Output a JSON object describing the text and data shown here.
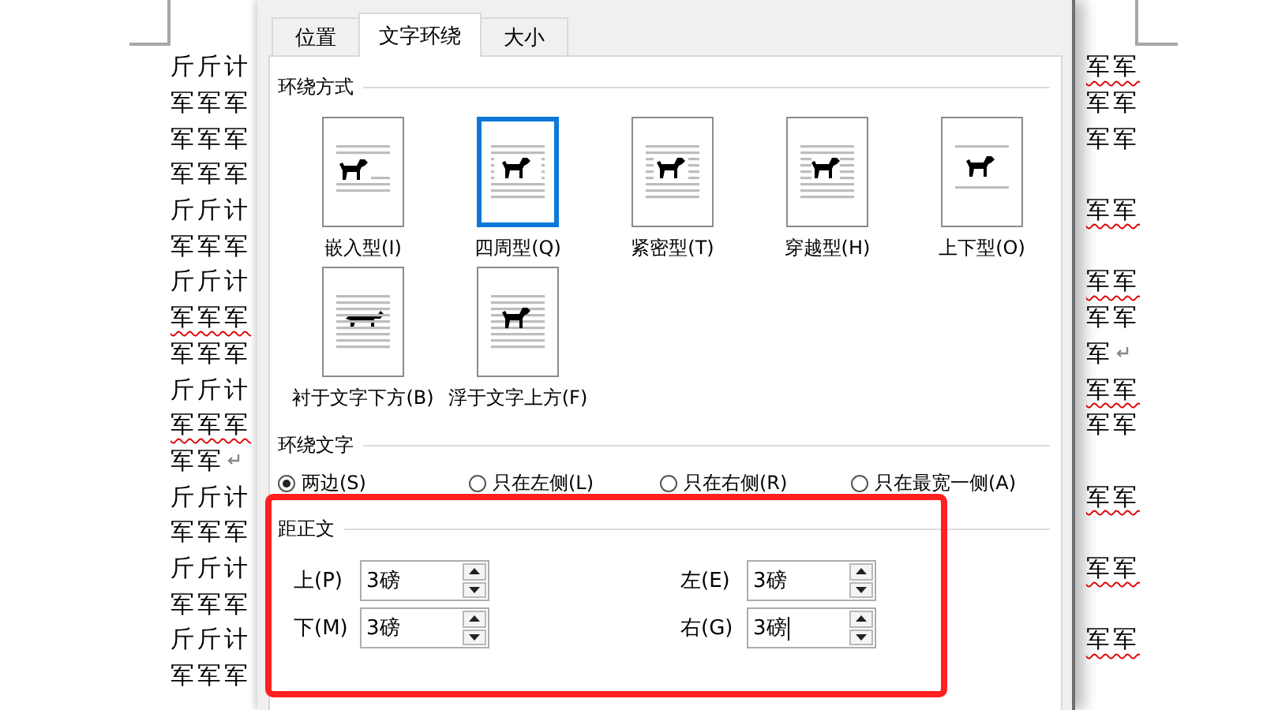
{
  "document": {
    "lines": [
      {
        "left": "斤斤计",
        "right": "军军",
        "left_flagged": false,
        "right_flagged": true
      },
      {
        "left": "军军军",
        "right": "军军",
        "left_flagged": false,
        "right_flagged": false
      },
      {
        "left": "军军军",
        "right": "军军",
        "left_flagged": false,
        "right_flagged": false
      },
      {
        "left": "军军军",
        "left_flagged": false
      },
      {
        "left": "斤斤计",
        "right": "军军",
        "left_flagged": false,
        "right_flagged": true
      },
      {
        "left": "军军军",
        "left_flagged": false
      },
      {
        "left": "斤斤计",
        "right": "军军",
        "left_flagged": false,
        "right_flagged": true
      },
      {
        "left": "军军军",
        "right": "军军",
        "left_flagged": true,
        "right_flagged": false
      },
      {
        "left": "军军军",
        "right": "军",
        "left_flagged": false,
        "right_flagged": false,
        "right_end_mark": true
      },
      {
        "left": "斤斤计",
        "right": "军军",
        "left_flagged": false,
        "right_flagged": true
      },
      {
        "left": "军军军",
        "right": "军军",
        "left_flagged": true,
        "right_flagged": false
      },
      {
        "left": "军军",
        "left_flagged": false,
        "left_end_mark": true
      },
      {
        "left": "斤斤计",
        "right": "军军",
        "left_flagged": false,
        "right_flagged": true
      },
      {
        "left": "军军军",
        "left_flagged": false
      },
      {
        "left": "斤斤计",
        "right": "军军",
        "left_flagged": false,
        "right_flagged": true
      },
      {
        "left": "军军军",
        "left_flagged": false
      },
      {
        "left": "斤斤计",
        "right": "军军",
        "left_flagged": false,
        "right_flagged": true
      },
      {
        "left": "军军军",
        "left_flagged": false
      }
    ]
  },
  "dialog": {
    "tabs": [
      {
        "label": "位置",
        "selected": false
      },
      {
        "label": "文字环绕",
        "selected": true
      },
      {
        "label": "大小",
        "selected": false
      }
    ],
    "wrap_style": {
      "title": "环绕方式",
      "options": [
        {
          "label": "嵌入型(I)",
          "kind": "inline",
          "selected": false
        },
        {
          "label": "四周型(Q)",
          "kind": "square",
          "selected": true
        },
        {
          "label": "紧密型(T)",
          "kind": "tight",
          "selected": false
        },
        {
          "label": "穿越型(H)",
          "kind": "through",
          "selected": false
        },
        {
          "label": "上下型(O)",
          "kind": "topbottom",
          "selected": false
        },
        {
          "label": "衬于文字下方(B)",
          "kind": "behind",
          "selected": false
        },
        {
          "label": "浮于文字上方(F)",
          "kind": "front",
          "selected": false
        }
      ]
    },
    "wrap_text": {
      "title": "环绕文字",
      "options": [
        {
          "label": "两边(S)",
          "selected": true
        },
        {
          "label": "只在左侧(L)",
          "selected": false
        },
        {
          "label": "只在右侧(R)",
          "selected": false
        },
        {
          "label": "只在最宽一侧(A)",
          "selected": false
        }
      ]
    },
    "distance": {
      "title": "距正文",
      "highlighted": true,
      "fields": [
        {
          "label": "上(P)",
          "value": "3磅",
          "focused": false
        },
        {
          "label": "左(E)",
          "value": "3磅",
          "focused": false
        },
        {
          "label": "下(M)",
          "value": "3磅",
          "focused": false
        },
        {
          "label": "右(G)",
          "value": "3磅",
          "focused": true
        }
      ]
    }
  }
}
